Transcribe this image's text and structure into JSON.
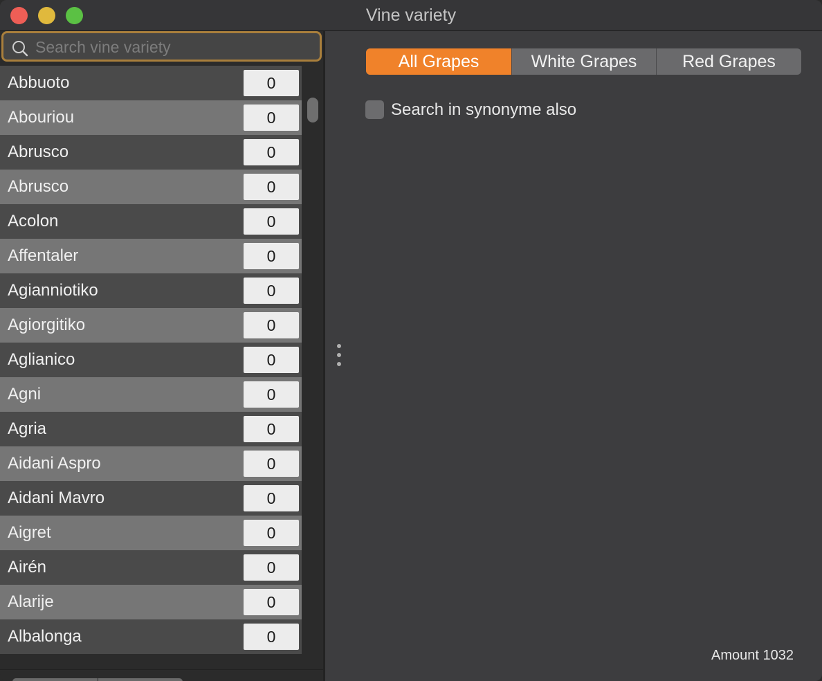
{
  "window": {
    "title": "Vine variety"
  },
  "search": {
    "placeholder": "Search vine variety",
    "value": ""
  },
  "varieties": [
    {
      "name": "Abbuoto",
      "count": "0"
    },
    {
      "name": "Abouriou",
      "count": "0"
    },
    {
      "name": "Abrusco",
      "count": "0"
    },
    {
      "name": "Abrusco",
      "count": "0"
    },
    {
      "name": "Acolon",
      "count": "0"
    },
    {
      "name": "Affentaler",
      "count": "0"
    },
    {
      "name": "Agianniotiko",
      "count": "0"
    },
    {
      "name": "Agiorgitiko",
      "count": "0"
    },
    {
      "name": "Aglianico",
      "count": "0"
    },
    {
      "name": "Agni",
      "count": "0"
    },
    {
      "name": "Agria",
      "count": "0"
    },
    {
      "name": "Aidani Aspro",
      "count": "0"
    },
    {
      "name": "Aidani Mavro",
      "count": "0"
    },
    {
      "name": "Aigret",
      "count": "0"
    },
    {
      "name": "Airén",
      "count": "0"
    },
    {
      "name": "Alarije",
      "count": "0"
    },
    {
      "name": "Albalonga",
      "count": "0"
    }
  ],
  "bottom_bar": {
    "add_label": "+",
    "remove_label": "−"
  },
  "filter": {
    "tabs": [
      "All Grapes",
      "White Grapes",
      "Red Grapes"
    ],
    "selected": "All Grapes",
    "accent_color": "#f0822a"
  },
  "synonym_option": {
    "label": "Search in synonyme also",
    "checked": false
  },
  "footer": {
    "amount": "Amount 1032"
  },
  "icons": {
    "search": "search-icon",
    "split_handle": "vertical-dots-icon"
  }
}
